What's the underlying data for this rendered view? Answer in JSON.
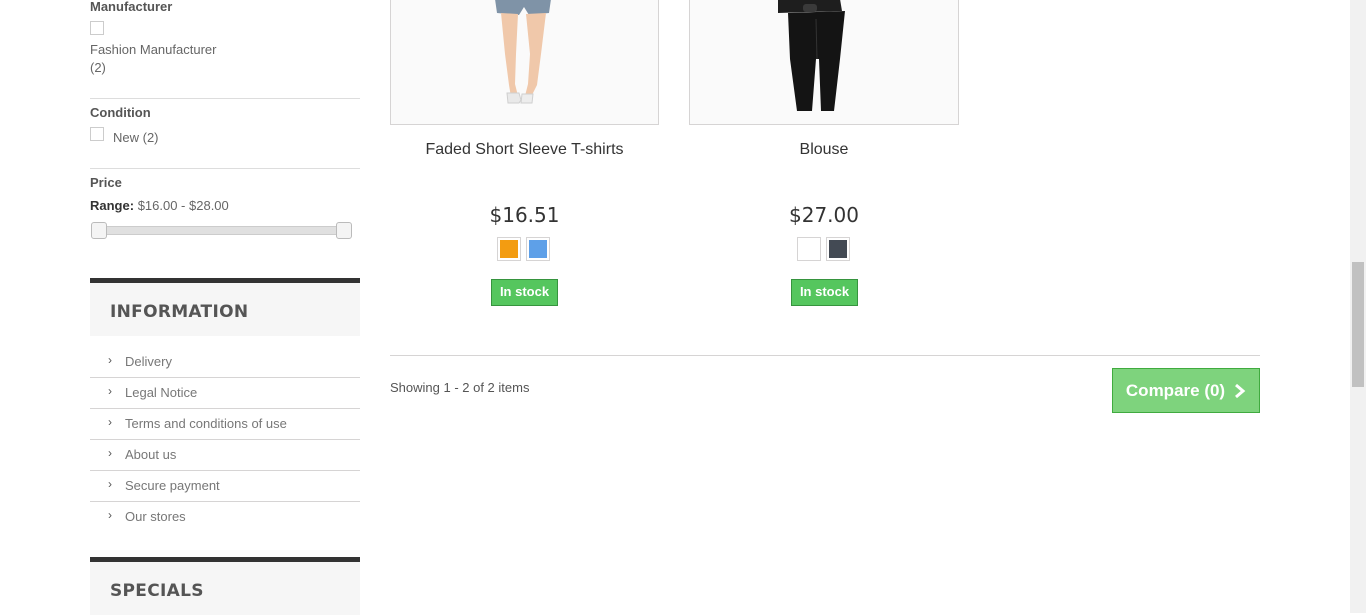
{
  "filters": {
    "manufacturer": {
      "title": "Manufacturer",
      "option_label": "Fashion Manufacturer",
      "option_count": "(2)"
    },
    "condition": {
      "title": "Condition",
      "option": "New (2)"
    },
    "price": {
      "title": "Price",
      "range_label": "Range:",
      "range_value": "$16.00 - $28.00"
    }
  },
  "information": {
    "title": "INFORMATION",
    "items": [
      {
        "label": "Delivery"
      },
      {
        "label": "Legal Notice"
      },
      {
        "label": "Terms and conditions of use"
      },
      {
        "label": "About us"
      },
      {
        "label": "Secure payment"
      },
      {
        "label": "Our stores"
      }
    ],
    "chevron_glyph": "›"
  },
  "specials": {
    "title": "SPECIALS"
  },
  "products": [
    {
      "name": "Faded Short Sleeve T-shirts",
      "price": "$16.51",
      "colors": [
        "#f39c11",
        "#5ea0e8"
      ],
      "stock": "In stock"
    },
    {
      "name": "Blouse",
      "price": "$27.00",
      "colors": [
        "#ffffff",
        "#434a54"
      ],
      "stock": "In stock"
    }
  ],
  "footer": {
    "showing": "Showing 1 - 2 of 2 items",
    "compare_label": "Compare (0)",
    "compare_icon": "chevron-right-icon"
  }
}
